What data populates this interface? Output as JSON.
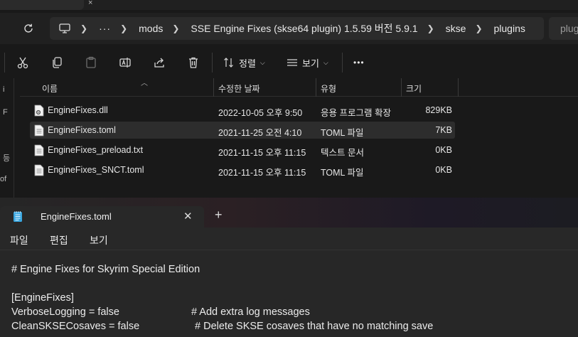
{
  "explorer": {
    "tab_close_glyph": "×",
    "breadcrumbs": [
      "mods",
      "SSE Engine Fixes (skse64 plugin) 1.5.59 버전 5.9.1",
      "skse",
      "plugins"
    ],
    "overflow_label": "···",
    "search_placeholder": "plugi",
    "toolbar": {
      "sort_label": "정렬",
      "view_label": "보기",
      "more_label": "•••"
    },
    "columns": {
      "name": "이름",
      "date": "수정한 날짜",
      "type": "유형",
      "size": "크기"
    },
    "nav_strip_glyphs": [
      "i",
      "F",
      "등",
      "of"
    ],
    "files": [
      {
        "name": "EngineFixes.dll",
        "date": "2022-10-05 오후 9:50",
        "type": "응용 프로그램 확장",
        "size": "829KB",
        "icon": "dll-file-icon"
      },
      {
        "name": "EngineFixes.toml",
        "date": "2021-11-25 오전 4:10",
        "type": "TOML 파일",
        "size": "7KB",
        "icon": "text-file-icon",
        "selected": true
      },
      {
        "name": "EngineFixes_preload.txt",
        "date": "2021-11-15 오후 11:15",
        "type": "텍스트 문서",
        "size": "0KB",
        "icon": "text-file-icon"
      },
      {
        "name": "EngineFixes_SNCT.toml",
        "date": "2021-11-15 오후 11:15",
        "type": "TOML 파일",
        "size": "0KB",
        "icon": "text-file-icon"
      }
    ]
  },
  "notepad": {
    "tab_title": "EngineFixes.toml",
    "tab_close": "✕",
    "new_tab": "+",
    "menu": [
      "파일",
      "편집",
      "보기"
    ],
    "lines": [
      {
        "text": "# Engine Fixes for Skyrim Special Edition",
        "comment": ""
      },
      {
        "text": "",
        "comment": ""
      },
      {
        "text": "[EngineFixes]",
        "comment": ""
      },
      {
        "text": "VerboseLogging = false",
        "comment": "# Add extra log messages"
      },
      {
        "text": "CleanSKSECosaves = false",
        "comment": "# Delete SKSE cosaves that have no matching save"
      }
    ]
  },
  "colors": {
    "explorer_bg": "#191919",
    "notepad_bg": "#272727",
    "selected_row": "#2d2d2d",
    "text": "#e6e6e6"
  }
}
